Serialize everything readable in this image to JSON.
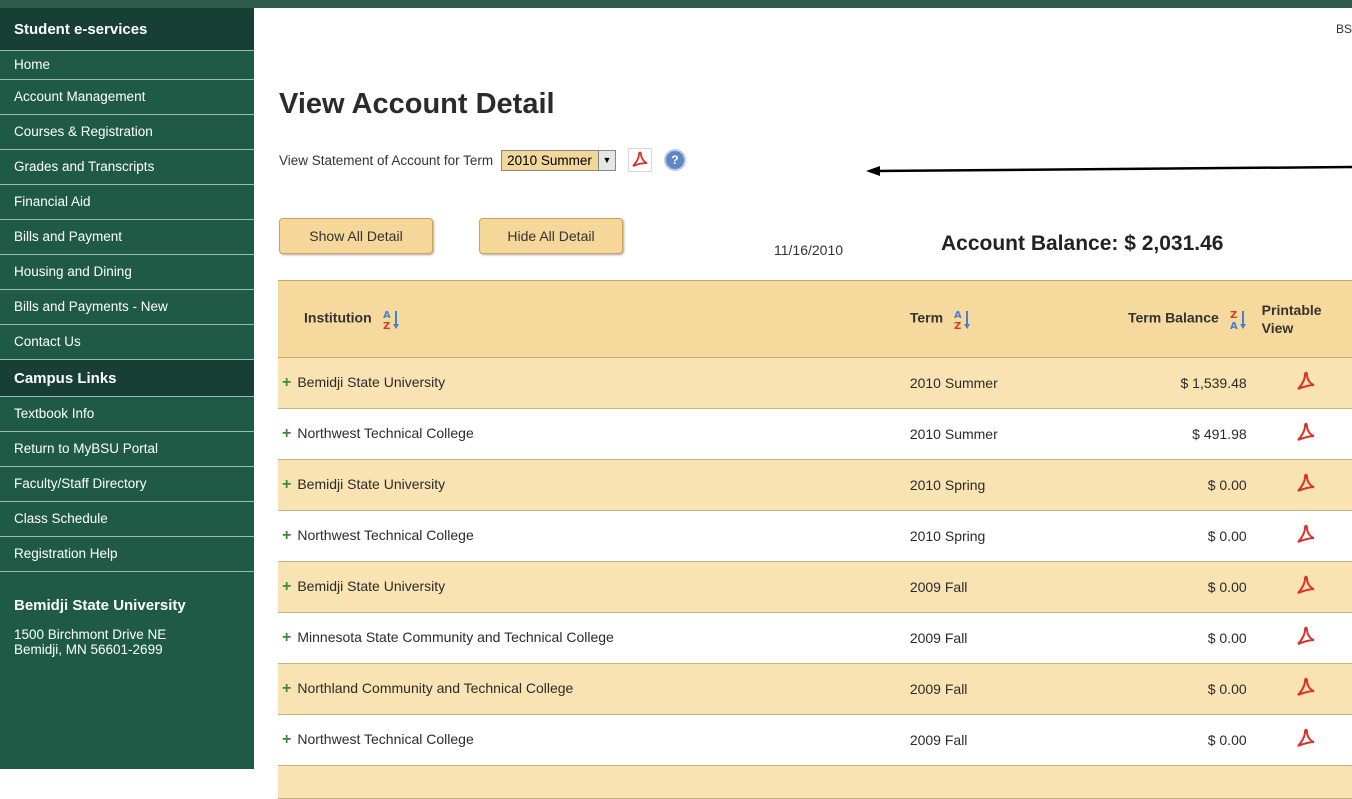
{
  "sidebar": {
    "header": "Student e-services",
    "items": [
      "Home",
      "Account Management",
      "Courses & Registration",
      "Grades and Transcripts",
      "Financial Aid",
      "Bills and Payment",
      "Housing and Dining",
      "Bills and Payments - New",
      "Contact Us"
    ],
    "campus_header": "Campus Links",
    "campus_items": [
      "Textbook Info",
      "Return to MyBSU Portal",
      "Faculty/Staff Directory",
      "Class Schedule",
      "Registration Help"
    ],
    "address": {
      "name": "Bemidji State University",
      "line1": "1500 Birchmont Drive NE",
      "line2": "Bemidji, MN 56601-2699"
    }
  },
  "header": {
    "corner_text": "BS"
  },
  "main": {
    "title": "View Account Detail",
    "term_label": "View Statement of Account for Term",
    "term_selected": "2010 Summer",
    "show_all": "Show All Detail",
    "hide_all": "Hide All Detail",
    "date": "11/16/2010",
    "balance": "Account Balance: $ 2,031.46"
  },
  "table": {
    "headers": {
      "institution": "Institution",
      "term": "Term",
      "balance": "Term Balance",
      "view_line1": "Printable",
      "view_line2": "View"
    },
    "rows": [
      {
        "institution": "Bemidji State University",
        "term": "2010 Summer",
        "balance": "$ 1,539.48"
      },
      {
        "institution": "Northwest Technical College",
        "term": "2010 Summer",
        "balance": "$ 491.98"
      },
      {
        "institution": "Bemidji State University",
        "term": "2010 Spring",
        "balance": "$ 0.00"
      },
      {
        "institution": "Northwest Technical College",
        "term": "2010 Spring",
        "balance": "$ 0.00"
      },
      {
        "institution": "Bemidji State University",
        "term": "2009 Fall",
        "balance": "$ 0.00"
      },
      {
        "institution": "Minnesota State Community and Technical College",
        "term": "2009 Fall",
        "balance": "$ 0.00"
      },
      {
        "institution": "Northland Community and Technical College",
        "term": "2009 Fall",
        "balance": "$ 0.00"
      },
      {
        "institution": "Northwest Technical College",
        "term": "2009 Fall",
        "balance": "$ 0.00"
      }
    ]
  },
  "colors": {
    "sidebar": "#1f5a47",
    "sidebar_header": "#173f33",
    "table_header": "#f6d99c",
    "row_alt": "#f9e3b3",
    "pdf_red": "#d8322b"
  },
  "icons": [
    "pdf-icon",
    "help-icon",
    "sort-az-icon",
    "sort-za-icon",
    "expand-plus-icon",
    "dropdown-arrow-icon"
  ]
}
